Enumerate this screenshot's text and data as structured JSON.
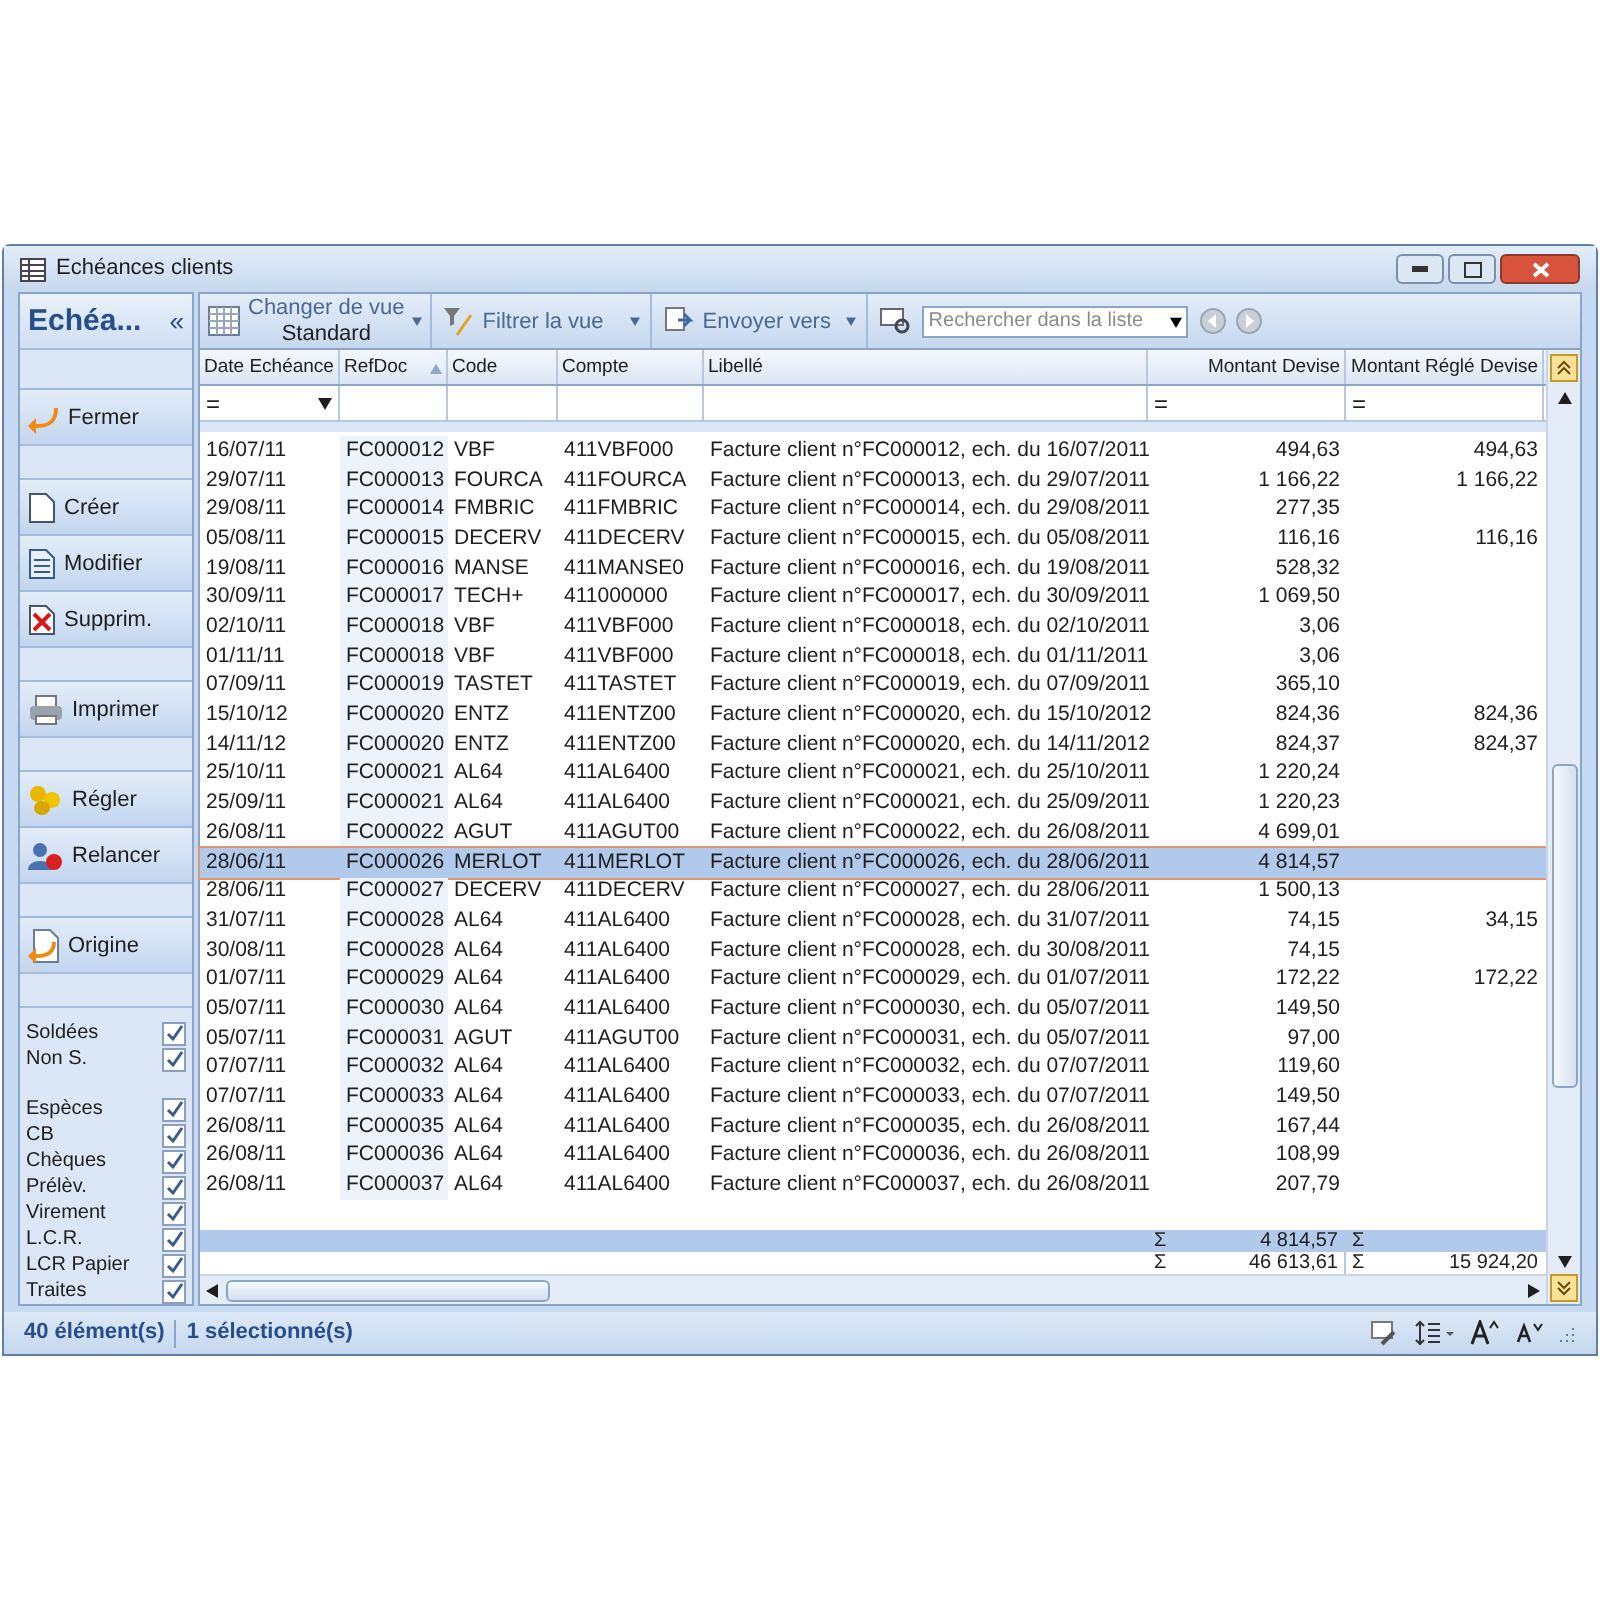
{
  "window": {
    "title": "Echéances clients"
  },
  "sidebar": {
    "title": "Echéa...",
    "collapse": "«",
    "button_groups": [
      [
        {
          "label": "Fermer"
        }
      ],
      [
        {
          "label": "Créer"
        },
        {
          "label": "Modifier"
        },
        {
          "label": "Supprim."
        }
      ],
      [
        {
          "label": "Imprimer"
        }
      ],
      [
        {
          "label": "Régler"
        },
        {
          "label": "Relancer"
        }
      ],
      [
        {
          "label": "Origine"
        }
      ]
    ],
    "filter_groups": [
      [
        {
          "label": "Soldées",
          "checked": true
        },
        {
          "label": "Non S.",
          "checked": true
        }
      ],
      [
        {
          "label": "Espèces",
          "checked": true
        },
        {
          "label": "CB",
          "checked": true
        },
        {
          "label": "Chèques",
          "checked": true
        },
        {
          "label": "Prélèv.",
          "checked": true
        },
        {
          "label": "Virement",
          "checked": true
        },
        {
          "label": "L.C.R.",
          "checked": true
        },
        {
          "label": "LCR Papier",
          "checked": true
        },
        {
          "label": "Traites",
          "checked": true
        }
      ]
    ]
  },
  "toolbar": {
    "view_label": "Changer de vue",
    "view_value": "Standard",
    "filter": "Filtrer la vue",
    "send": "Envoyer vers",
    "search": {
      "placeholder": "Rechercher dans la liste"
    }
  },
  "table": {
    "columns": [
      {
        "label": "Date Echéance",
        "filter": "="
      },
      {
        "label": "RefDoc"
      },
      {
        "label": "Code"
      },
      {
        "label": "Compte"
      },
      {
        "label": "Libellé"
      },
      {
        "label": "Montant Devise",
        "filter": "="
      },
      {
        "label": "Montant Réglé Devise",
        "filter": "="
      }
    ],
    "rows": [
      {
        "cells": [
          "16/07/11",
          "FC000012",
          "VBF",
          "411VBF000",
          "Facture client n°FC000012, ech. du 16/07/2011",
          "494,63",
          "494,63"
        ],
        "selected": false
      },
      {
        "cells": [
          "29/07/11",
          "FC000013",
          "FOURCA",
          "411FOURCA",
          "Facture client n°FC000013, ech. du 29/07/2011",
          "1 166,22",
          "1 166,22"
        ],
        "selected": false
      },
      {
        "cells": [
          "29/08/11",
          "FC000014",
          "FMBRIC",
          "411FMBRIC",
          "Facture client n°FC000014, ech. du 29/08/2011",
          "277,35",
          ""
        ],
        "selected": false
      },
      {
        "cells": [
          "05/08/11",
          "FC000015",
          "DECERV",
          "411DECERV",
          "Facture client n°FC000015, ech. du 05/08/2011",
          "116,16",
          "116,16"
        ],
        "selected": false
      },
      {
        "cells": [
          "19/08/11",
          "FC000016",
          "MANSE",
          "411MANSE0",
          "Facture client n°FC000016, ech. du 19/08/2011",
          "528,32",
          ""
        ],
        "selected": false
      },
      {
        "cells": [
          "30/09/11",
          "FC000017",
          "TECH+",
          "411000000",
          "Facture client n°FC000017, ech. du 30/09/2011",
          "1 069,50",
          ""
        ],
        "selected": false
      },
      {
        "cells": [
          "02/10/11",
          "FC000018",
          "VBF",
          "411VBF000",
          "Facture client n°FC000018, ech. du 02/10/2011",
          "3,06",
          ""
        ],
        "selected": false
      },
      {
        "cells": [
          "01/11/11",
          "FC000018",
          "VBF",
          "411VBF000",
          "Facture client n°FC000018, ech. du 01/11/2011",
          "3,06",
          ""
        ],
        "selected": false
      },
      {
        "cells": [
          "07/09/11",
          "FC000019",
          "TASTET",
          "411TASTET",
          "Facture client n°FC000019, ech. du 07/09/2011",
          "365,10",
          ""
        ],
        "selected": false
      },
      {
        "cells": [
          "15/10/12",
          "FC000020",
          "ENTZ",
          "411ENTZ00",
          "Facture client n°FC000020, ech. du 15/10/2012",
          "824,36",
          "824,36"
        ],
        "selected": false
      },
      {
        "cells": [
          "14/11/12",
          "FC000020",
          "ENTZ",
          "411ENTZ00",
          "Facture client n°FC000020, ech. du 14/11/2012",
          "824,37",
          "824,37"
        ],
        "selected": false
      },
      {
        "cells": [
          "25/10/11",
          "FC000021",
          "AL64",
          "411AL6400",
          "Facture client n°FC000021, ech. du 25/10/2011",
          "1 220,24",
          ""
        ],
        "selected": false
      },
      {
        "cells": [
          "25/09/11",
          "FC000021",
          "AL64",
          "411AL6400",
          "Facture client n°FC000021, ech. du 25/09/2011",
          "1 220,23",
          ""
        ],
        "selected": false
      },
      {
        "cells": [
          "26/08/11",
          "FC000022",
          "AGUT",
          "411AGUT00",
          "Facture client n°FC000022, ech. du 26/08/2011",
          "4 699,01",
          ""
        ],
        "selected": false
      },
      {
        "cells": [
          "28/06/11",
          "FC000026",
          "MERLOT",
          "411MERLOT",
          "Facture client n°FC000026, ech. du 28/06/2011",
          "4 814,57",
          ""
        ],
        "selected": true
      },
      {
        "cells": [
          "28/06/11",
          "FC000027",
          "DECERV",
          "411DECERV",
          "Facture client n°FC000027, ech. du 28/06/2011",
          "1 500,13",
          ""
        ],
        "selected": false
      },
      {
        "cells": [
          "31/07/11",
          "FC000028",
          "AL64",
          "411AL6400",
          "Facture client n°FC000028, ech. du 31/07/2011",
          "74,15",
          "34,15"
        ],
        "selected": false
      },
      {
        "cells": [
          "30/08/11",
          "FC000028",
          "AL64",
          "411AL6400",
          "Facture client n°FC000028, ech. du 30/08/2011",
          "74,15",
          ""
        ],
        "selected": false
      },
      {
        "cells": [
          "01/07/11",
          "FC000029",
          "AL64",
          "411AL6400",
          "Facture client n°FC000029, ech. du 01/07/2011",
          "172,22",
          "172,22"
        ],
        "selected": false
      },
      {
        "cells": [
          "05/07/11",
          "FC000030",
          "AL64",
          "411AL6400",
          "Facture client n°FC000030, ech. du 05/07/2011",
          "149,50",
          ""
        ],
        "selected": false
      },
      {
        "cells": [
          "05/07/11",
          "FC000031",
          "AGUT",
          "411AGUT00",
          "Facture client n°FC000031, ech. du 05/07/2011",
          "97,00",
          ""
        ],
        "selected": false
      },
      {
        "cells": [
          "07/07/11",
          "FC000032",
          "AL64",
          "411AL6400",
          "Facture client n°FC000032, ech. du 07/07/2011",
          "119,60",
          ""
        ],
        "selected": false
      },
      {
        "cells": [
          "07/07/11",
          "FC000033",
          "AL64",
          "411AL6400",
          "Facture client n°FC000033, ech. du 07/07/2011",
          "149,50",
          ""
        ],
        "selected": false
      },
      {
        "cells": [
          "26/08/11",
          "FC000035",
          "AL64",
          "411AL6400",
          "Facture client n°FC000035, ech. du 26/08/2011",
          "167,44",
          ""
        ],
        "selected": false
      },
      {
        "cells": [
          "26/08/11",
          "FC000036",
          "AL64",
          "411AL6400",
          "Facture client n°FC000036, ech. du 26/08/2011",
          "108,99",
          ""
        ],
        "selected": false
      },
      {
        "cells": [
          "26/08/11",
          "FC000037",
          "AL64",
          "411AL6400",
          "Facture client n°FC000037, ech. du 26/08/2011",
          "207,79",
          ""
        ],
        "selected": false
      }
    ],
    "totals": [
      {
        "kind": "selection",
        "cells": [
          "Σ",
          "4 814,57",
          "Σ",
          ""
        ]
      },
      {
        "kind": "all",
        "cells": [
          "Σ",
          "46 613,61",
          "Σ",
          "15 924,20"
        ]
      }
    ]
  },
  "status_bar": {
    "count": "40 élément(s)",
    "selected": "1 sélectionné(s)"
  }
}
